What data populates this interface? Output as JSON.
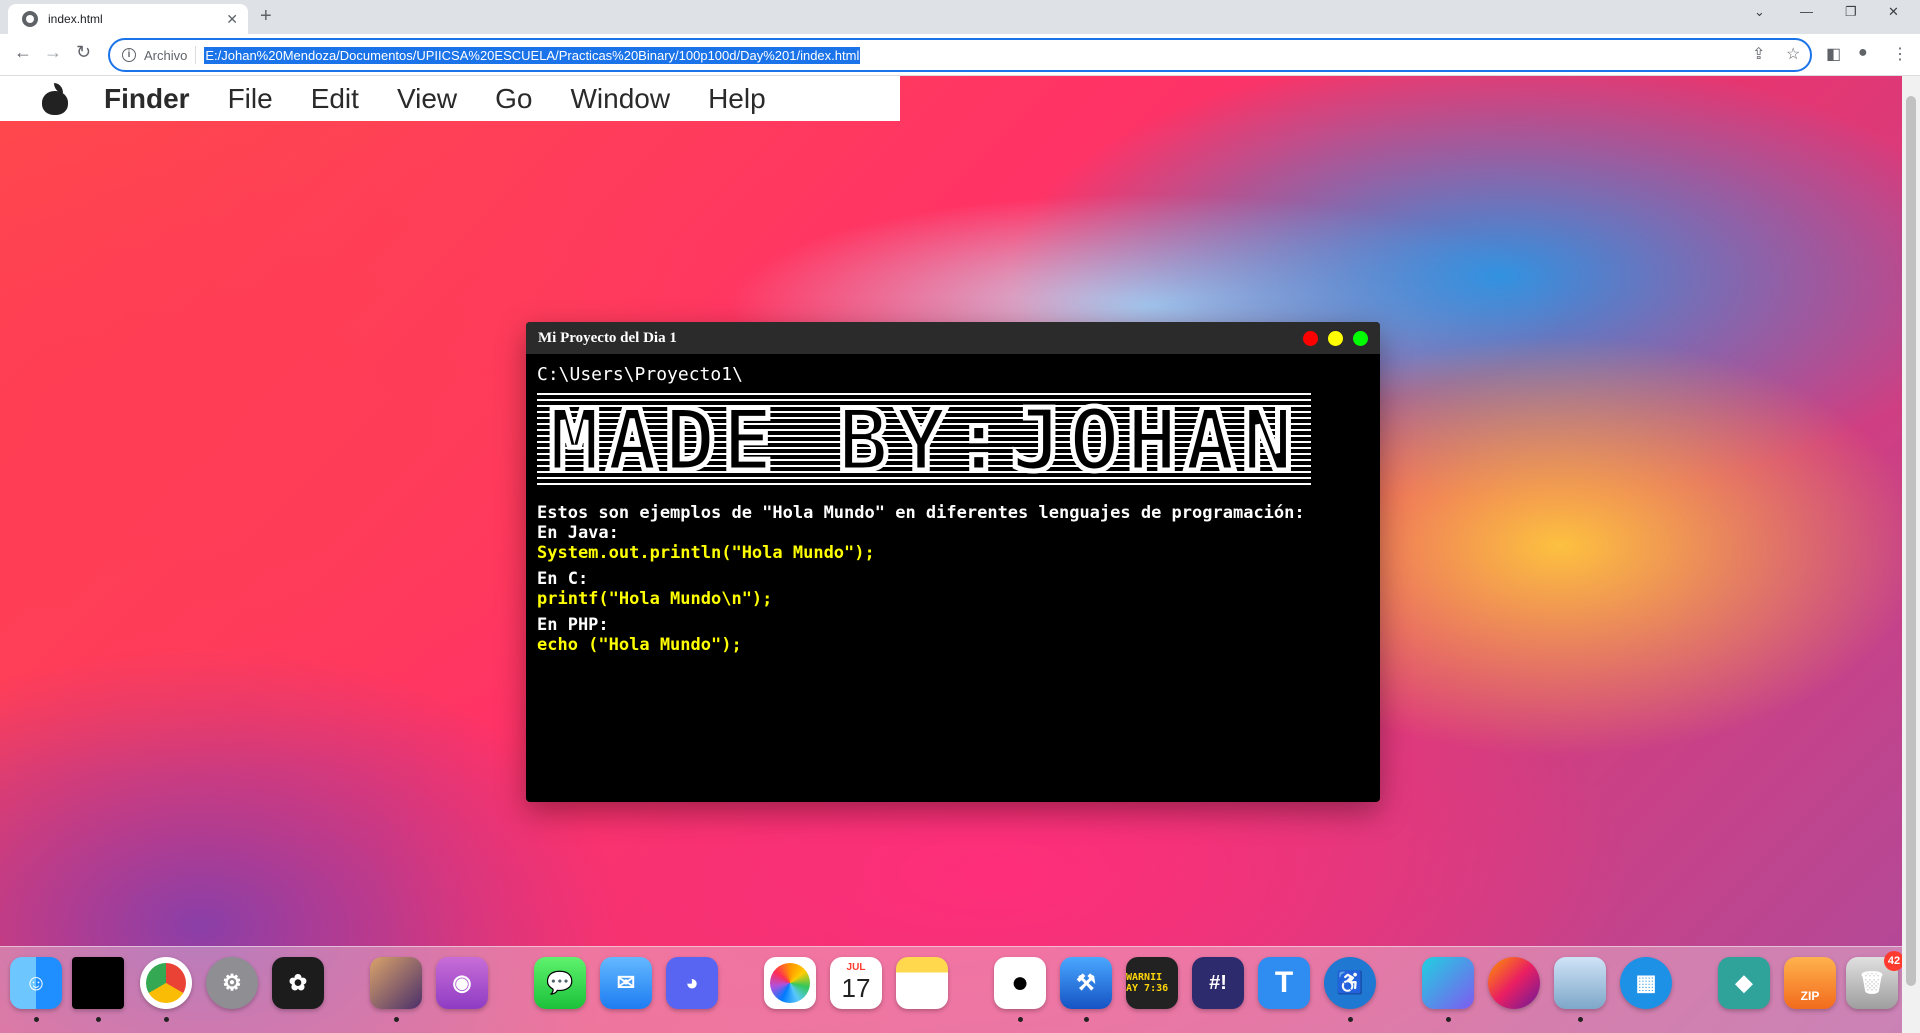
{
  "browser": {
    "tab_title": "index.html",
    "new_tab": "+",
    "scheme_label": "Archivo",
    "url": "E:/Johan%20Mendoza/Documentos/UPIICSA%20ESCUELA/Practicas%20Binary/100p100d/Day%201/index.html",
    "accent_color": "#1a73e8"
  },
  "menubar": {
    "items": [
      "Finder",
      "File",
      "Edit",
      "View",
      "Go",
      "Window",
      "Help"
    ]
  },
  "terminal": {
    "title": "Mi Proyecto del Dia 1",
    "traffic_colors": [
      "#ff0000",
      "#ffff00",
      "#00ff00"
    ],
    "path": "C:\\Users\\Proyecto1\\",
    "banner": "MADE BY:JOHAN",
    "intro": "Estos son ejemplos de \"Hola Mundo\" en diferentes lenguajes de programación:",
    "examples": [
      {
        "lang": "En Java:",
        "code": "System.out.println(\"Hola Mundo\");"
      },
      {
        "lang": "En C:",
        "code": "printf(\"Hola Mundo\\n\");"
      },
      {
        "lang": "En PHP:",
        "code": "echo (\"Hola Mundo\");"
      }
    ],
    "code_color": "#ffff00"
  },
  "dock": {
    "calendar_month": "JUL",
    "calendar_day": "17",
    "console_label": "WARNII AY 7:36",
    "github_label": "#!",
    "t_label": "T",
    "zip_label": "ZIP",
    "trash_badge": "42",
    "apps": [
      "finder-icon",
      "activity-monitor-icon",
      "chrome-icon",
      "system-preferences-icon",
      "davinci-icon",
      "photo-app-icon",
      "podcasts-icon",
      "messages-icon",
      "mail-icon",
      "discord-icon",
      "photos-icon",
      "calendar-icon",
      "notes-icon",
      "github-icon",
      "xcode-icon",
      "console-icon",
      "hashtag-app-icon",
      "typora-icon",
      "accessibility-icon",
      "screens-icon",
      "firefox-icon",
      "preview-icon",
      "docker-icon",
      "sourcetree-icon",
      "archive-icon",
      "trash-icon"
    ]
  }
}
